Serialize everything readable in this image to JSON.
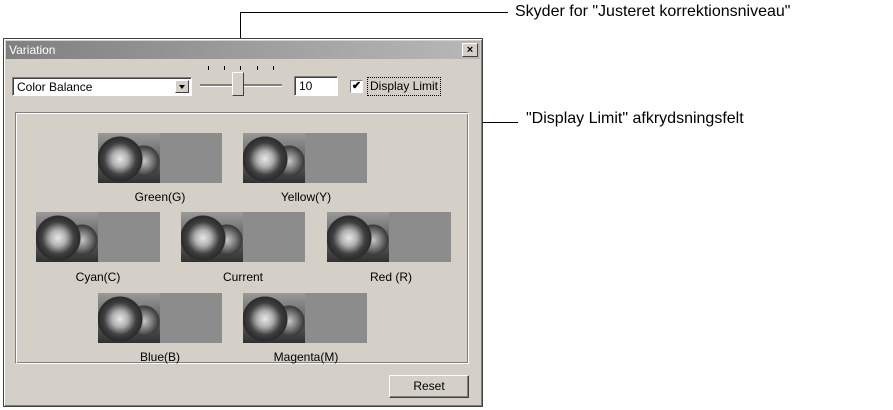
{
  "window": {
    "title": "Variation",
    "close_glyph": "×"
  },
  "controls": {
    "mode_select_value": "Color Balance",
    "level_value": "10",
    "display_limit_checked": true,
    "display_limit_label": "Display Limit"
  },
  "variations": [
    {
      "label": "Green(G)"
    },
    {
      "label": "Yellow(Y)"
    },
    {
      "label": "Cyan(C)"
    },
    {
      "label": "Current"
    },
    {
      "label": "Red (R)"
    },
    {
      "label": "Blue(B)"
    },
    {
      "label": "Magenta(M)"
    }
  ],
  "reset_label": "Reset",
  "callouts": {
    "slider": "Skyder for \"Justeret korrektionsniveau\"",
    "checkbox": "\"Display Limit\" afkrydsningsfelt"
  },
  "icons": {
    "close": "close-icon",
    "dropdown": "chevron-down-icon",
    "check": "check-icon"
  }
}
